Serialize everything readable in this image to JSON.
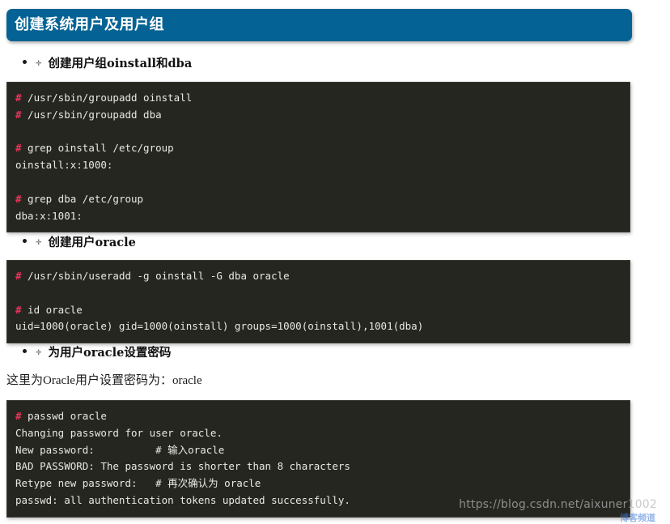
{
  "banner": {
    "title": "创建系统用户及用户组"
  },
  "bullets": {
    "marker_dot": "•",
    "marker_arrow": "✛",
    "items": [
      {
        "text": "创建用户组oinstall和dba"
      },
      {
        "text": "创建用户oracle"
      },
      {
        "text": "为用户oracle设置密码"
      }
    ]
  },
  "paragraphs": [
    {
      "text": "这里为Oracle用户设置密码为：oracle"
    }
  ],
  "code_blocks": [
    {
      "lines": [
        {
          "prompt": "#",
          "code": " /usr/sbin/groupadd oinstall"
        },
        {
          "prompt": "#",
          "code": " /usr/sbin/groupadd dba"
        },
        {
          "prompt": "",
          "code": ""
        },
        {
          "prompt": "#",
          "code": " grep oinstall /etc/group"
        },
        {
          "prompt": "",
          "code": "oinstall:x:1000:"
        },
        {
          "prompt": "",
          "code": ""
        },
        {
          "prompt": "#",
          "code": " grep dba /etc/group"
        },
        {
          "prompt": "",
          "code": "dba:x:1001:"
        }
      ]
    },
    {
      "lines": [
        {
          "prompt": "#",
          "code": " /usr/sbin/useradd -g oinstall -G dba oracle"
        },
        {
          "prompt": "",
          "code": ""
        },
        {
          "prompt": "#",
          "code": " id oracle"
        },
        {
          "prompt": "",
          "code": "uid=1000(oracle) gid=1000(oinstall) groups=1000(oinstall),1001(dba)"
        }
      ]
    },
    {
      "lines": [
        {
          "prompt": "#",
          "code": " passwd oracle"
        },
        {
          "prompt": "",
          "code": "Changing password for user oracle."
        },
        {
          "prompt": "",
          "code": "New password:          # 输入oracle"
        },
        {
          "prompt": "",
          "code": "BAD PASSWORD: The password is shorter than 8 characters"
        },
        {
          "prompt": "",
          "code": "Retype new password:   # 再次确认为 oracle"
        },
        {
          "prompt": "",
          "code": "passwd: all authentication tokens updated successfully."
        }
      ]
    }
  ],
  "watermark": {
    "url": "https://blog.csdn.net/aixuner1002",
    "badge": "博客频道"
  },
  "colors": {
    "banner_bg": "#046394",
    "code_bg": "#262621",
    "prompt": "#e8345a",
    "code_fg": "#e9e9e4",
    "page_bg": "#ffffff"
  }
}
